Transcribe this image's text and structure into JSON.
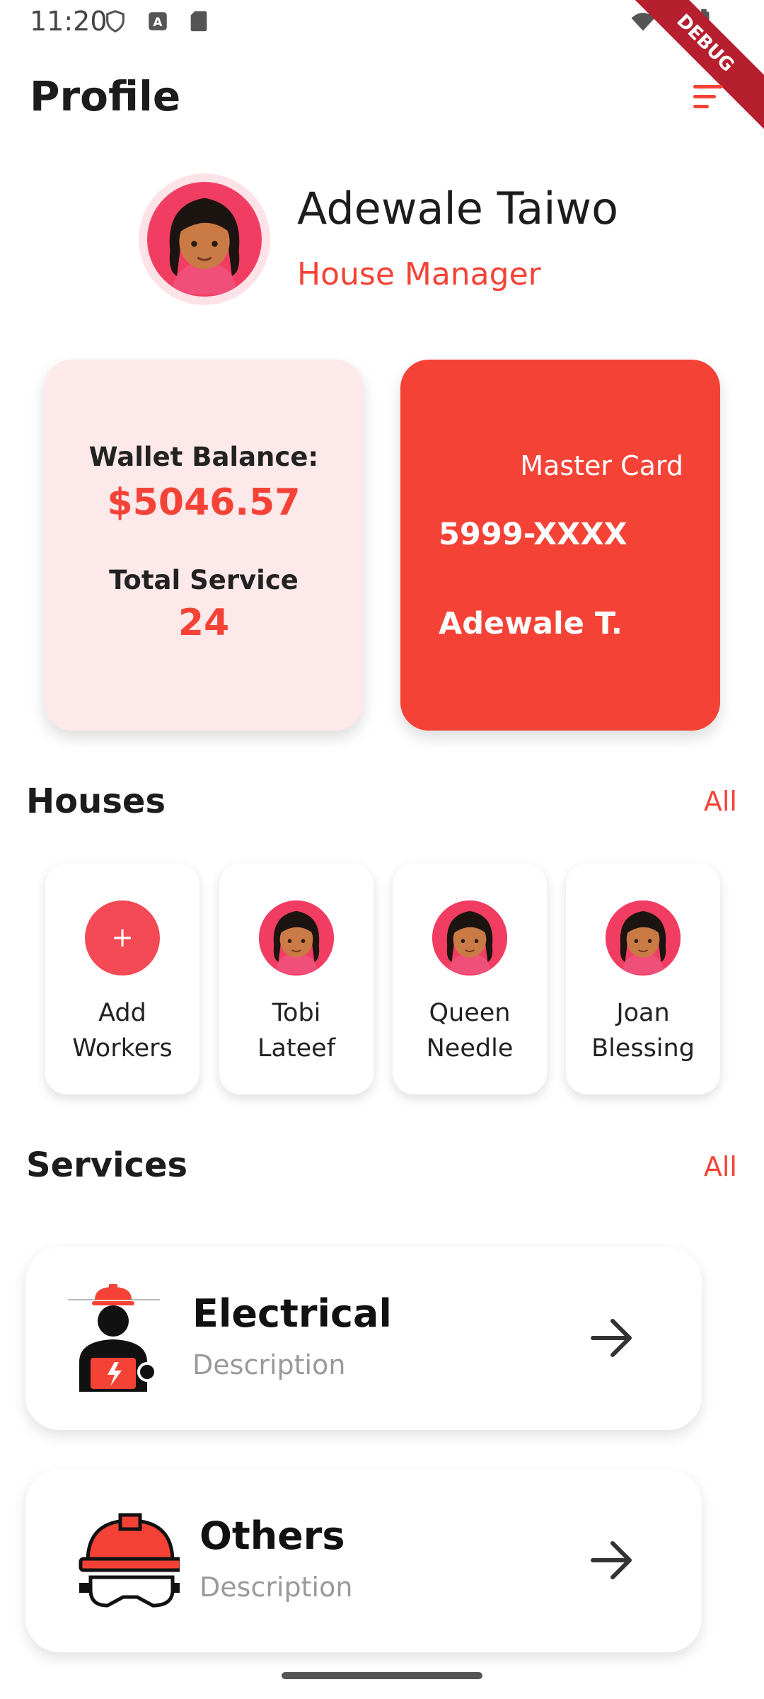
{
  "status_bar": {
    "time": "11:20",
    "debug_label": "DEBUG"
  },
  "header": {
    "title": "Profile"
  },
  "profile": {
    "name": "Adewale Taiwo",
    "role": "House Manager"
  },
  "wallet_card": {
    "balance_label": "Wallet Balance:",
    "balance_value": "$5046.57",
    "service_label": "Total Service",
    "service_value": "24"
  },
  "master_card": {
    "label": "Master Card",
    "number": "5999-XXXX",
    "holder": "Adewale T."
  },
  "houses": {
    "title": "Houses",
    "all_label": "All",
    "add": {
      "icon": "+",
      "line1": "Add",
      "line2": "Workers"
    },
    "workers": [
      {
        "line1": "Tobi",
        "line2": "Lateef"
      },
      {
        "line1": "Queen",
        "line2": "Needle"
      },
      {
        "line1": "Joan",
        "line2": "Blessing"
      }
    ]
  },
  "services": {
    "title": "Services",
    "all_label": "All",
    "items": [
      {
        "title": "Electrical",
        "description": "Description",
        "icon": "electrician-icon"
      },
      {
        "title": "Others",
        "description": "Description",
        "icon": "helmet-goggles-icon"
      }
    ]
  },
  "colors": {
    "accent": "#f44336",
    "wallet_bg": "#fde8ea",
    "avatar_bg": "#f23d62"
  }
}
